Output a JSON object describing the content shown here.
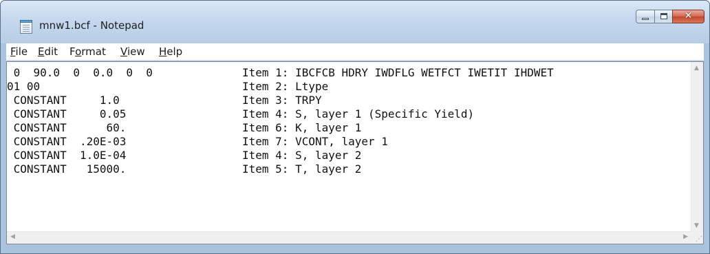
{
  "window": {
    "title": "mnw1.bcf - Notepad",
    "icon": "notepad-icon",
    "controls": {
      "minimize": "minimize-icon",
      "maximize": "maximize-icon",
      "close": "close-icon"
    }
  },
  "menu": {
    "items": [
      {
        "pre": "",
        "key": "F",
        "post": "ile"
      },
      {
        "pre": "",
        "key": "E",
        "post": "dit"
      },
      {
        "pre": "F",
        "key": "o",
        "post": "rmat"
      },
      {
        "pre": "",
        "key": "V",
        "post": "iew"
      },
      {
        "pre": "",
        "key": "H",
        "post": "elp"
      }
    ]
  },
  "editor": {
    "lines": [
      {
        "value": " 0  90.0  0  0.0  0  0",
        "comment": "Item 1: IBCFCB HDRY IWDFLG WETFCT IWETIT IHDWET"
      },
      {
        "value": "01 00",
        "comment": "Item 2: Ltype"
      },
      {
        "value": " CONSTANT     1.0",
        "comment": "Item 3: TRPY"
      },
      {
        "value": " CONSTANT     0.05",
        "comment": "Item 4: S, layer 1 (Specific Yield)"
      },
      {
        "value": " CONSTANT      60.",
        "comment": "Item 6: K, layer 1"
      },
      {
        "value": " CONSTANT  .20E-03",
        "comment": "Item 7: VCONT, layer 1"
      },
      {
        "value": " CONSTANT  1.0E-04",
        "comment": "Item 4: S, layer 2"
      },
      {
        "value": " CONSTANT   15000.",
        "comment": "Item 5: T, layer 2"
      }
    ]
  },
  "scrollbars": {
    "up_arrow": "scroll-up-arrow-icon",
    "down_arrow": "scroll-down-arrow-icon",
    "left_arrow": "scroll-left-arrow-icon",
    "right_arrow": "scroll-right-arrow-icon",
    "grip": "resize-grip-icon"
  }
}
